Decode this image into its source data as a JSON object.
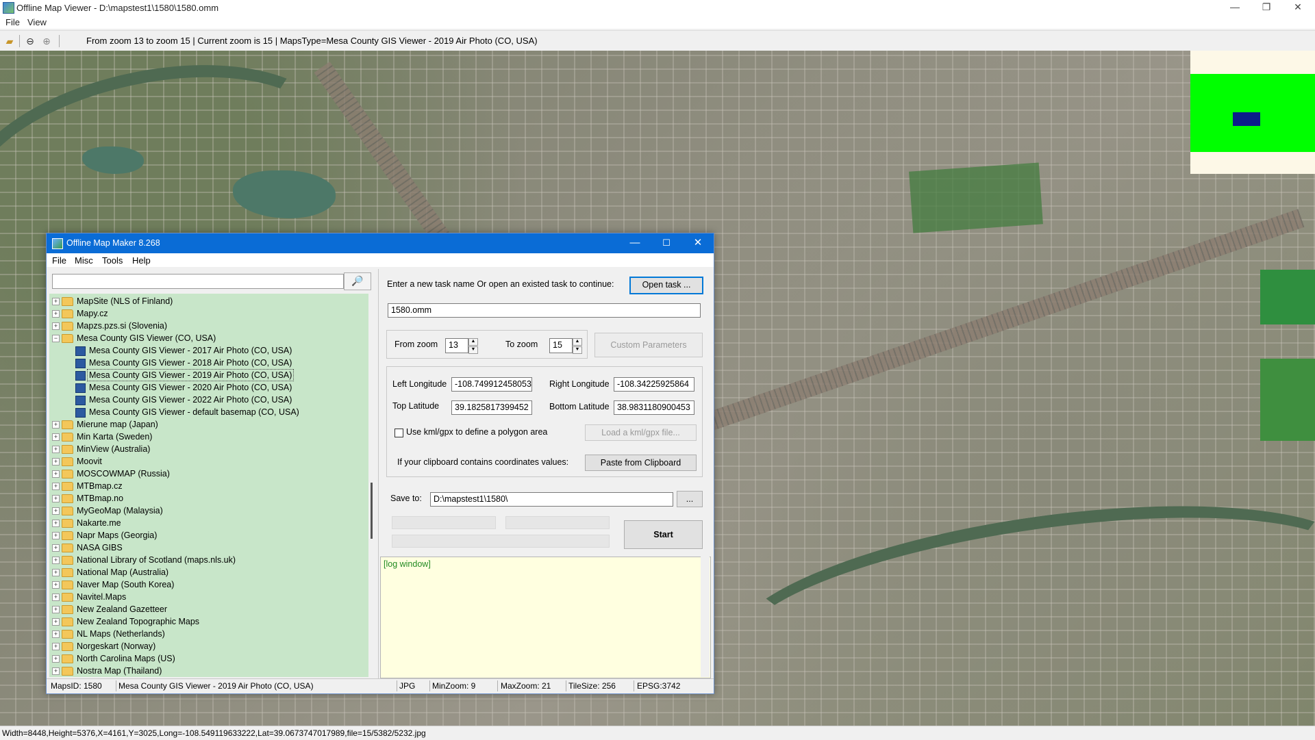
{
  "window": {
    "title": "Offline Map Viewer - D:\\mapstest1\\1580\\1580.omm",
    "minimize": "—",
    "maximize": "❐",
    "close": "✕"
  },
  "menu": {
    "file": "File",
    "view": "View"
  },
  "toolbar": {
    "info": "From zoom 13 to zoom 15   |   Current zoom is 15  |   MapsType=Mesa County GIS Viewer - 2019 Air Photo (CO, USA)"
  },
  "statusbar": {
    "text": "Width=8448,Height=5376,X=4161,Y=3025,Long=-108.549119633222,Lat=39.0673747017989,file=15/5382/5232.jpg"
  },
  "dialog": {
    "title": "Offline Map Maker 8.268",
    "menu": [
      "File",
      "Misc",
      "Tools",
      "Help"
    ],
    "search": {
      "value": "",
      "icon": "🔎"
    },
    "tree": [
      {
        "label": "MapSite (NLS of Finland)",
        "level": 0,
        "type": "folder",
        "expander": "+"
      },
      {
        "label": "Mapy.cz",
        "level": 0,
        "type": "folder",
        "expander": "+"
      },
      {
        "label": "Mapzs.pzs.si (Slovenia)",
        "level": 0,
        "type": "folder",
        "expander": "+"
      },
      {
        "label": "Mesa County GIS Viewer (CO, USA)",
        "level": 0,
        "type": "folder-open",
        "expander": "−"
      },
      {
        "label": "Mesa County GIS Viewer - 2017 Air Photo (CO, USA)",
        "level": 1,
        "type": "map"
      },
      {
        "label": "Mesa County GIS Viewer - 2018 Air Photo (CO, USA)",
        "level": 1,
        "type": "map"
      },
      {
        "label": "Mesa County GIS Viewer - 2019 Air Photo (CO, USA)",
        "level": 1,
        "type": "map",
        "selected": true
      },
      {
        "label": "Mesa County GIS Viewer - 2020 Air Photo (CO, USA)",
        "level": 1,
        "type": "map"
      },
      {
        "label": "Mesa County GIS Viewer - 2022 Air Photo (CO, USA)",
        "level": 1,
        "type": "map"
      },
      {
        "label": "Mesa County GIS Viewer - default basemap (CO, USA)",
        "level": 1,
        "type": "map"
      },
      {
        "label": "Mierune map (Japan)",
        "level": 0,
        "type": "folder",
        "expander": "+"
      },
      {
        "label": "Min Karta (Sweden)",
        "level": 0,
        "type": "folder",
        "expander": "+"
      },
      {
        "label": "MinView (Australia)",
        "level": 0,
        "type": "folder",
        "expander": "+"
      },
      {
        "label": "Moovit",
        "level": 0,
        "type": "folder",
        "expander": "+"
      },
      {
        "label": "MOSCOWMAP (Russia)",
        "level": 0,
        "type": "folder",
        "expander": "+"
      },
      {
        "label": "MTBmap.cz",
        "level": 0,
        "type": "folder",
        "expander": "+"
      },
      {
        "label": "MTBmap.no",
        "level": 0,
        "type": "folder",
        "expander": "+"
      },
      {
        "label": "MyGeoMap (Malaysia)",
        "level": 0,
        "type": "folder",
        "expander": "+"
      },
      {
        "label": "Nakarte.me",
        "level": 0,
        "type": "folder",
        "expander": "+"
      },
      {
        "label": "Napr Maps (Georgia)",
        "level": 0,
        "type": "folder",
        "expander": "+"
      },
      {
        "label": "NASA GIBS",
        "level": 0,
        "type": "folder",
        "expander": "+"
      },
      {
        "label": "National Library of Scotland (maps.nls.uk)",
        "level": 0,
        "type": "folder",
        "expander": "+"
      },
      {
        "label": "National Map (Australia)",
        "level": 0,
        "type": "folder",
        "expander": "+"
      },
      {
        "label": "Naver Map (South Korea)",
        "level": 0,
        "type": "folder",
        "expander": "+"
      },
      {
        "label": "Navitel.Maps",
        "level": 0,
        "type": "folder",
        "expander": "+"
      },
      {
        "label": "New Zealand Gazetteer",
        "level": 0,
        "type": "folder",
        "expander": "+"
      },
      {
        "label": "New Zealand Topographic Maps",
        "level": 0,
        "type": "folder",
        "expander": "+"
      },
      {
        "label": "NL Maps (Netherlands)",
        "level": 0,
        "type": "folder",
        "expander": "+"
      },
      {
        "label": "Norgeskart (Norway)",
        "level": 0,
        "type": "folder",
        "expander": "+"
      },
      {
        "label": "North Carolina Maps (US)",
        "level": 0,
        "type": "folder",
        "expander": "+"
      },
      {
        "label": "Nostra Map (Thailand)",
        "level": 0,
        "type": "folder",
        "expander": "+"
      }
    ],
    "task": {
      "prompt": "Enter a new task name Or open an existed task to continue:",
      "open_button": "Open task ...",
      "name_value": "1580.omm"
    },
    "zoom": {
      "from_label": "From zoom",
      "from_value": "13",
      "to_label": "To zoom",
      "to_value": "15",
      "custom_button": "Custom Parameters"
    },
    "coords": {
      "left_lon_label": "Left Longitude",
      "left_lon_value": "-108.749912458053",
      "right_lon_label": "Right Longitude",
      "right_lon_value": "-108.34225925864",
      "top_lat_label": "Top Latitude",
      "top_lat_value": "39.1825817399452",
      "bottom_lat_label": "Bottom Latitude",
      "bottom_lat_value": "38.9831180900453",
      "kml_label": "Use kml/gpx to define a polygon area",
      "kml_button": "Load a kml/gpx file...",
      "clipboard_label": "If your clipboard contains coordinates values:",
      "clipboard_button": "Paste from Clipboard"
    },
    "save": {
      "label": "Save to:",
      "value": "D:\\mapstest1\\1580\\",
      "browse": "...",
      "start": "Start"
    },
    "log": {
      "text": "[log window]"
    },
    "status": {
      "maps_id": "MapsID: 1580",
      "map_name": "Mesa County GIS Viewer - 2019 Air Photo (CO, USA)",
      "format": "JPG",
      "min_zoom": "MinZoom: 9",
      "max_zoom": "MaxZoom: 21",
      "tile_size": "TileSize: 256",
      "epsg": "EPSG:3742"
    },
    "controls": {
      "minimize": "—",
      "maximize": "☐",
      "close": "✕"
    }
  },
  "colors": {
    "dialog_title": "#0a6cd6",
    "tree_bg": "#c8e6c9",
    "overview_green": "#00ff00",
    "overview_marker": "#0b1d8a",
    "log_bg": "#ffffe0"
  }
}
